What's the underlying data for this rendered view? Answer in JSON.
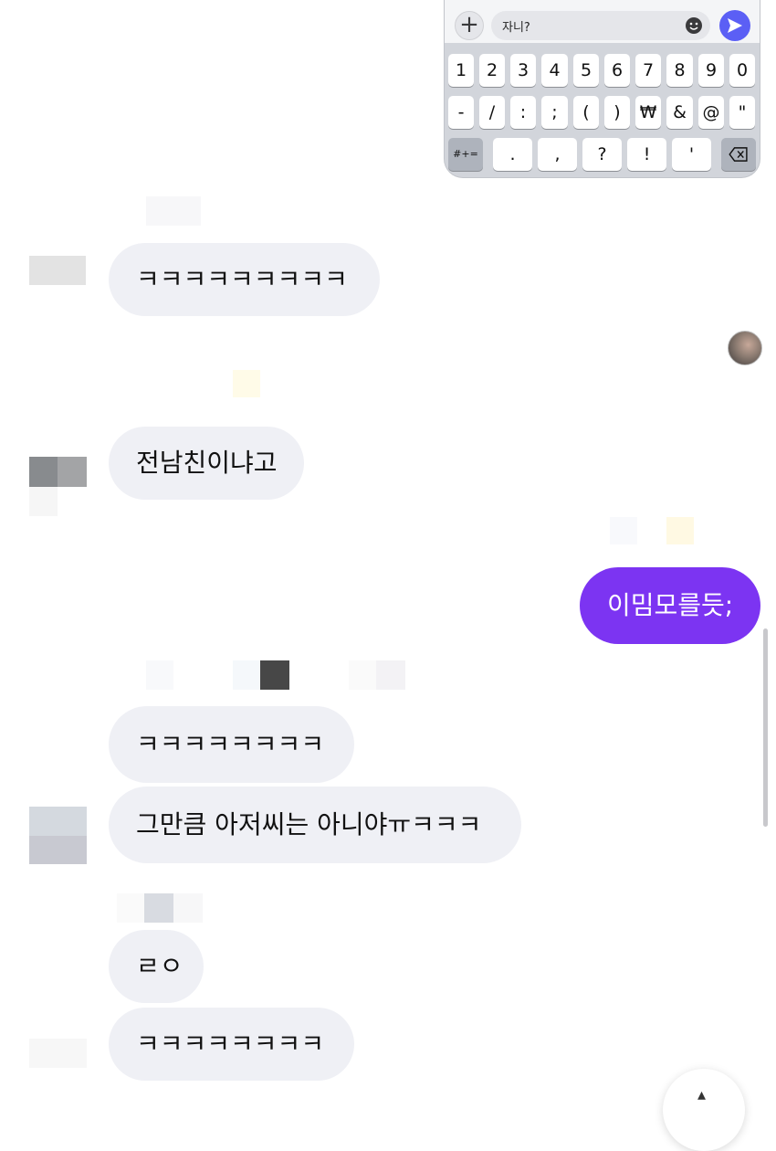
{
  "keyboard": {
    "input_text": "자니?",
    "plus_symbol": "+",
    "row1": [
      "1",
      "2",
      "3",
      "4",
      "5",
      "6",
      "7",
      "8",
      "9",
      "0"
    ],
    "row2": [
      "-",
      "/",
      ":",
      ";",
      "(",
      ")",
      "₩",
      "&",
      "@",
      "\""
    ],
    "row3": [
      "#+=",
      ".",
      ",",
      "?",
      "!",
      "'",
      "⌫"
    ]
  },
  "messages": [
    {
      "text": "ㅋㅋㅋㅋㅋㅋㅋㅋㅋ"
    },
    {
      "text": "전남친이냐고"
    },
    {
      "text": "이밈모를듯;"
    },
    {
      "text": "ㅋㅋㅋㅋㅋㅋㅋㅋ"
    },
    {
      "text": "그만큼 아저씨는 아니야ㅠㅋㅋㅋ"
    },
    {
      "text": "ㄹㅇ"
    },
    {
      "text": "ㅋㅋㅋㅋㅋㅋㅋㅋ"
    }
  ],
  "colors": {
    "incoming_bubble": "#eff0f5",
    "outgoing_bubble": "#7c34f2",
    "send_button": "#5b5ff5"
  }
}
